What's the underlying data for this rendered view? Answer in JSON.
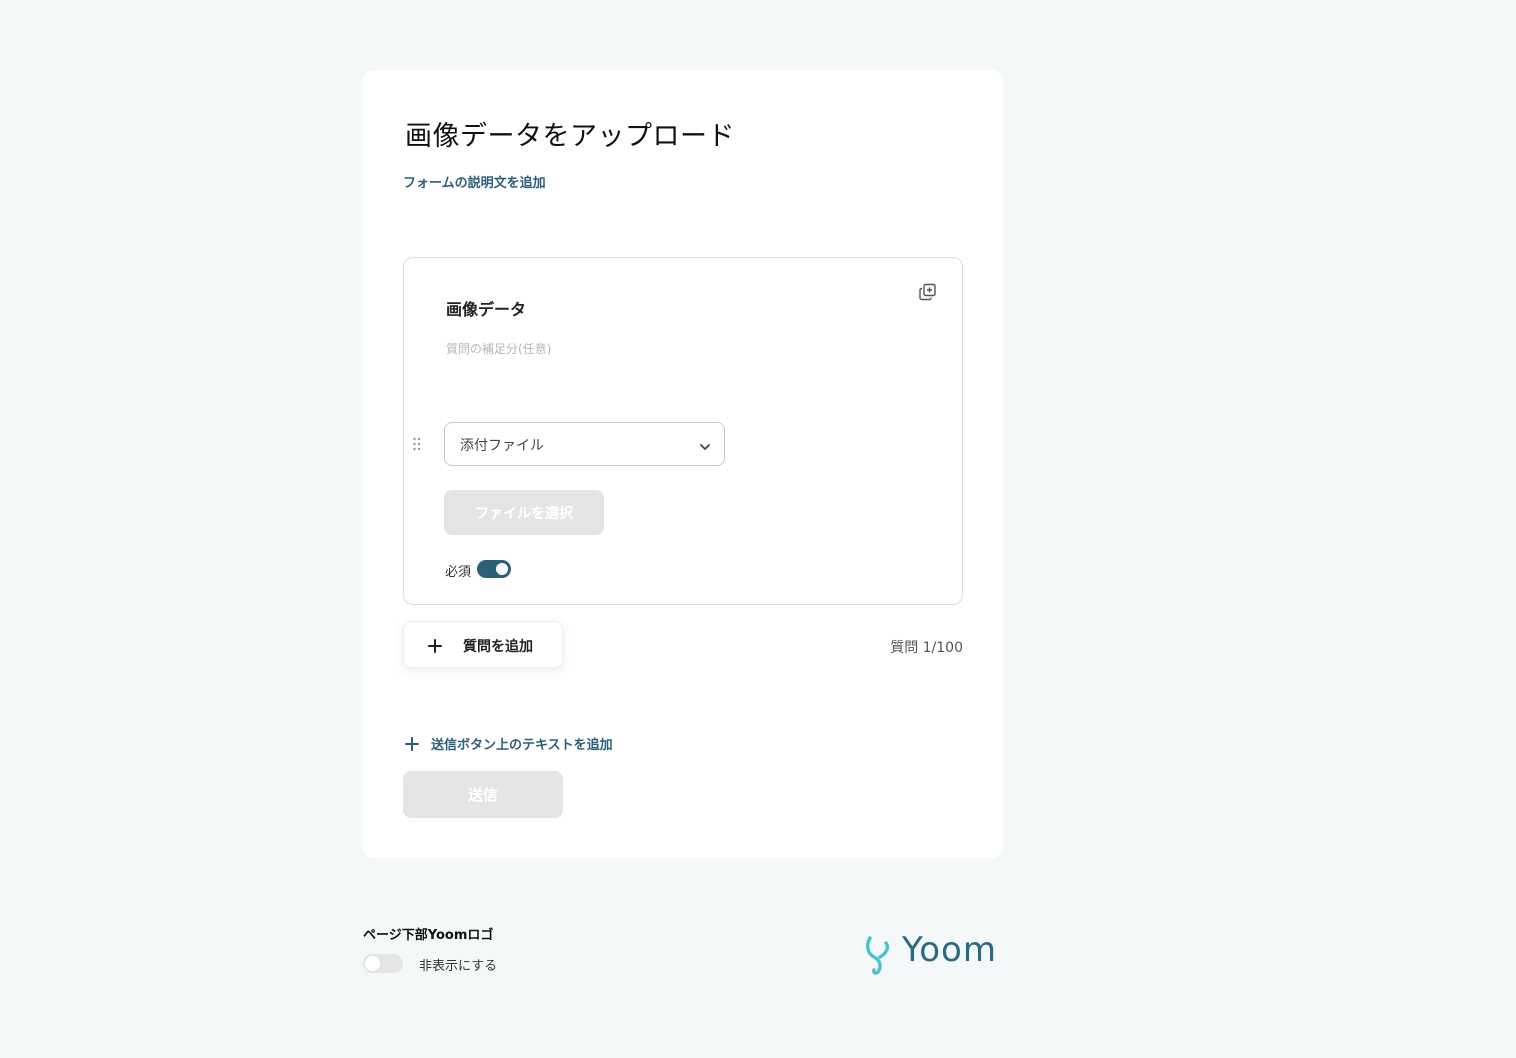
{
  "form": {
    "title": "画像データをアップロード",
    "add_description_link": "フォームの説明文を追加"
  },
  "question": {
    "title": "画像データ",
    "help_placeholder": "質問の補足分(任意)",
    "type_select_value": "添付ファイル",
    "file_button_label": "ファイルを選択",
    "required_label": "必須",
    "required_on": true
  },
  "actions": {
    "add_question_label": "質問を追加",
    "question_count": "質問 1/100",
    "add_submit_text_label": "送信ボタン上のテキストを追加",
    "submit_label": "送信"
  },
  "footer": {
    "logo_setting_title": "ページ下部Yoomロゴ",
    "hide_label": "非表示にする",
    "hide_on": false,
    "brand_name": "Yoom"
  },
  "colors": {
    "accent": "#2c6079",
    "brand": "#2a6b84",
    "brand_mark": "#4cc2cf",
    "disabled": "#e5e5e5"
  },
  "icons": {
    "duplicate": "duplicate-icon",
    "drag": "drag-handle-icon",
    "chevron": "chevron-down-icon",
    "plus": "plus-icon"
  }
}
